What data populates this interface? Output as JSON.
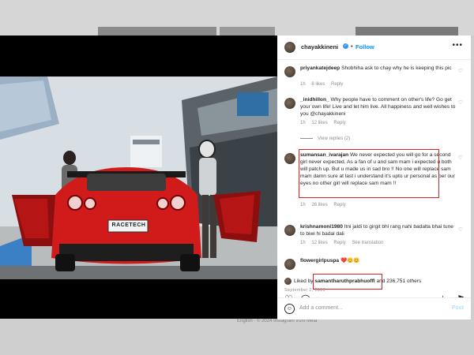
{
  "background": {
    "footer_text": "English  ·  © 2024 Instagram from Meta"
  },
  "post": {
    "username": "chayakkineni",
    "verified_mark": "✓",
    "separator": "•",
    "follow_label": "Follow",
    "more_icon": "more-horizontal-icon",
    "photo": {
      "plate_text": "RACETECH"
    }
  },
  "comments": [
    {
      "username": "priyankatejdeep",
      "text": "Shobhiha ask to chay why he is keeping this pic",
      "time": "1h",
      "likes": "8 likes",
      "reply": "Reply"
    },
    {
      "username": "_inidhillon_",
      "text": "Why people have to comment on other's life? Go get your own life! Live and let him live. All happiness and well wishes to you @chayakkineni",
      "time": "1h",
      "likes": "12 likes",
      "reply": "Reply"
    },
    {
      "username": "sumansan_ivarajan",
      "text": "We never expected you will go for a second girl never expected. As a fan of u and sam mam i expected u both will patch up. But u made us in sad bro !! No one will replace sam mam damn sure at last i understand it's upto ur personal as per our eyes no other girl will replace sam mam !!",
      "time": "1h",
      "likes": "26 likes",
      "reply": "Reply"
    },
    {
      "username": "krishnamoni1980",
      "text": "Itni jaldi to girgit bhi rang nahi badalta bhai tune to biwi hi badal dali",
      "time": "1h",
      "likes": "12 likes",
      "reply": "Reply",
      "extra": "See translation"
    },
    {
      "username": "flowergirlpuspa",
      "text": "❤️😊😊",
      "time": "",
      "likes": "",
      "reply": ""
    }
  ],
  "view_replies": "View replies (2)",
  "liked_by": {
    "prefix": "Liked by",
    "user": "samantharuthprabhuoffl",
    "suffix": "and 236,751 others"
  },
  "date": "September 2, 2018",
  "add_comment": {
    "placeholder": "Add a comment...",
    "post_label": "Post"
  },
  "colors": {
    "accent": "#0095f6",
    "highlight": "#e02020",
    "car_red": "#d11a1a"
  }
}
